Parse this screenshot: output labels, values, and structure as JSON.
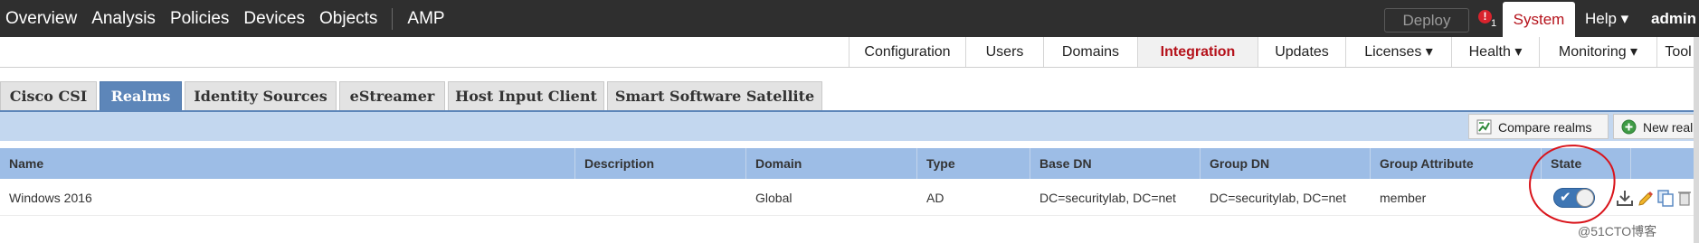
{
  "top_nav": {
    "items": [
      "Overview",
      "Analysis",
      "Policies",
      "Devices",
      "Objects",
      "AMP"
    ],
    "deploy_label": "Deploy",
    "alert_icon": "alert-icon",
    "alert_count": "1",
    "system_label": "System",
    "help_label": "Help ▾",
    "user_label": "admin"
  },
  "sub_nav": {
    "items": [
      {
        "label": "Configuration",
        "active": false
      },
      {
        "label": "Users",
        "active": false
      },
      {
        "label": "Domains",
        "active": false
      },
      {
        "label": "Integration",
        "active": true
      },
      {
        "label": "Updates",
        "active": false
      },
      {
        "label": "Licenses ▾",
        "active": false
      },
      {
        "label": "Health ▾",
        "active": false
      },
      {
        "label": "Monitoring ▾",
        "active": false
      },
      {
        "label": "Tool",
        "active": false
      }
    ]
  },
  "tabs": [
    {
      "label": "Cisco CSI",
      "active": false
    },
    {
      "label": "Realms",
      "active": true
    },
    {
      "label": "Identity Sources",
      "active": false
    },
    {
      "label": "eStreamer",
      "active": false
    },
    {
      "label": "Host Input Client",
      "active": false
    },
    {
      "label": "Smart Software Satellite",
      "active": false
    }
  ],
  "toolbar": {
    "compare_label": "Compare realms",
    "new_label": "New real"
  },
  "table": {
    "headers": [
      "Name",
      "Description",
      "Domain",
      "Type",
      "Base DN",
      "Group DN",
      "Group Attribute",
      "State"
    ],
    "rows": [
      {
        "name": "Windows 2016",
        "description": "",
        "domain": "Global",
        "type": "AD",
        "base_dn": "DC=securitylab, DC=net",
        "group_dn": "DC=securitylab, DC=net",
        "group_attribute": "member",
        "state": "enabled"
      }
    ]
  },
  "row_actions": [
    "download-icon",
    "edit-pencil-icon",
    "copy-icon",
    "delete-icon"
  ],
  "watermark": "@51CTO博客",
  "colors": {
    "topbar": "#2f2f2f",
    "accent_red": "#b5121b",
    "tab_active": "#5d86b9",
    "table_header": "#9dbde6",
    "toggle_on": "#3e76b4",
    "annotation": "#d9141b"
  }
}
